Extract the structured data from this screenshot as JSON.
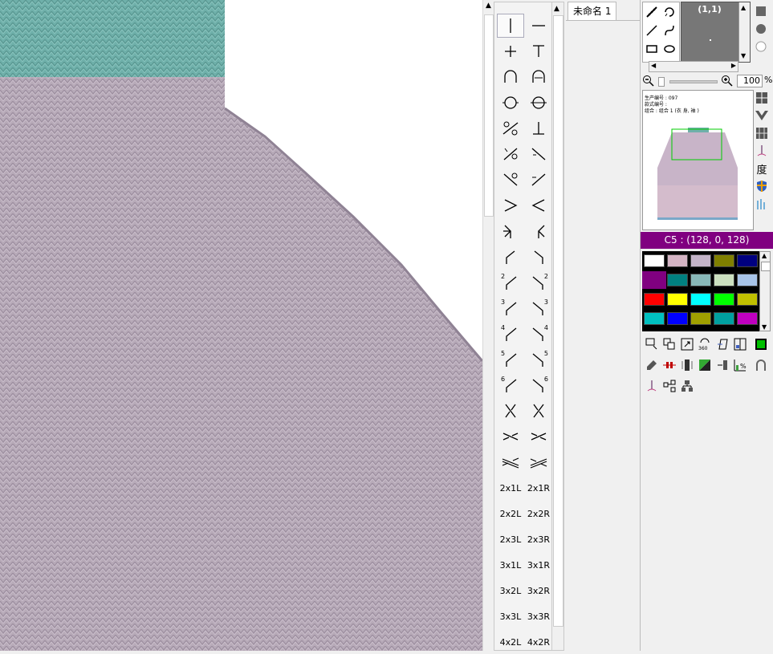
{
  "document": {
    "tab_label": "未命名 1"
  },
  "canvas": {
    "yoke_color": "#6fb0aa",
    "body_color": "#b7aab8"
  },
  "stitch_palette": {
    "items": [
      {
        "label": "",
        "icon": "vline"
      },
      {
        "label": "",
        "icon": "hline"
      },
      {
        "label": "",
        "icon": "plus"
      },
      {
        "label": "",
        "icon": "t-shape"
      },
      {
        "label": "",
        "icon": "arch"
      },
      {
        "label": "",
        "icon": "arch-dot"
      },
      {
        "label": "",
        "icon": "circle-h"
      },
      {
        "label": "",
        "icon": "circle-v"
      },
      {
        "label": "",
        "icon": "slash-circles"
      },
      {
        "label": "",
        "icon": "inverted-t"
      },
      {
        "label": "",
        "icon": "slash-left-a"
      },
      {
        "label": "",
        "icon": "slash-right-a"
      },
      {
        "label": "",
        "icon": "slash-left-b"
      },
      {
        "label": "",
        "icon": "slash-right-b"
      },
      {
        "label": "",
        "icon": "chevron-right"
      },
      {
        "label": "",
        "icon": "chevron-left"
      },
      {
        "label": "",
        "icon": "fork-left"
      },
      {
        "label": "",
        "icon": "fork-right"
      },
      {
        "label": "",
        "icon": "bend-left"
      },
      {
        "label": "",
        "icon": "bend-right"
      },
      {
        "label": "2",
        "icon": "bend-left-num"
      },
      {
        "label": "2",
        "icon": "bend-right-num"
      },
      {
        "label": "3",
        "icon": "bend-left-num"
      },
      {
        "label": "3",
        "icon": "bend-right-num"
      },
      {
        "label": "4",
        "icon": "bend-left-num"
      },
      {
        "label": "4",
        "icon": "bend-right-num"
      },
      {
        "label": "5",
        "icon": "bend-left-num"
      },
      {
        "label": "5",
        "icon": "bend-right-num"
      },
      {
        "label": "6",
        "icon": "bend-left-num"
      },
      {
        "label": "6",
        "icon": "bend-right-num"
      },
      {
        "label": "",
        "icon": "cross-left"
      },
      {
        "label": "",
        "icon": "cross-right"
      },
      {
        "label": "",
        "icon": "cross-flat-l"
      },
      {
        "label": "",
        "icon": "cross-flat-r"
      },
      {
        "label": "",
        "icon": "cross-double-l"
      },
      {
        "label": "",
        "icon": "cross-double-r"
      },
      {
        "label": "2x1L",
        "icon": "text"
      },
      {
        "label": "2x1R",
        "icon": "text"
      },
      {
        "label": "2x2L",
        "icon": "text"
      },
      {
        "label": "2x2R",
        "icon": "text"
      },
      {
        "label": "2x3L",
        "icon": "text"
      },
      {
        "label": "2x3R",
        "icon": "text"
      },
      {
        "label": "3x1L",
        "icon": "text"
      },
      {
        "label": "3x1R",
        "icon": "text"
      },
      {
        "label": "3x2L",
        "icon": "text"
      },
      {
        "label": "3x2R",
        "icon": "text"
      },
      {
        "label": "3x3L",
        "icon": "text"
      },
      {
        "label": "3x3R",
        "icon": "text"
      },
      {
        "label": "4x2L",
        "icon": "text"
      },
      {
        "label": "4x2R",
        "icon": "text"
      }
    ]
  },
  "preview": {
    "coord": "(1,1)"
  },
  "zoom": {
    "value": "100",
    "unit": "%"
  },
  "thumbnail": {
    "line1": "生产编号 : 097",
    "line2": "款式编号 :",
    "line3": "组合 : 组合 1 (衣 身, 袖 )"
  },
  "side_icons": {
    "degree_label": "度"
  },
  "color": {
    "header": "C5 : (128, 0, 128)",
    "selected": "#800080",
    "swatches": [
      [
        "#ffffff",
        "#d4b4c4",
        "#c4b4c8",
        "#808000",
        "#000080"
      ],
      [
        "#800080",
        "#008080",
        "#88b8b8",
        "#cce0c0",
        "#a8c4e8"
      ],
      [
        "#ff0000",
        "#ffff00",
        "#00ffff",
        "#00ff00",
        "#c0c000"
      ],
      [
        "#00c0c0",
        "#0000ff",
        "#a0a000",
        "#00a0a0",
        "#c000c0"
      ]
    ]
  }
}
